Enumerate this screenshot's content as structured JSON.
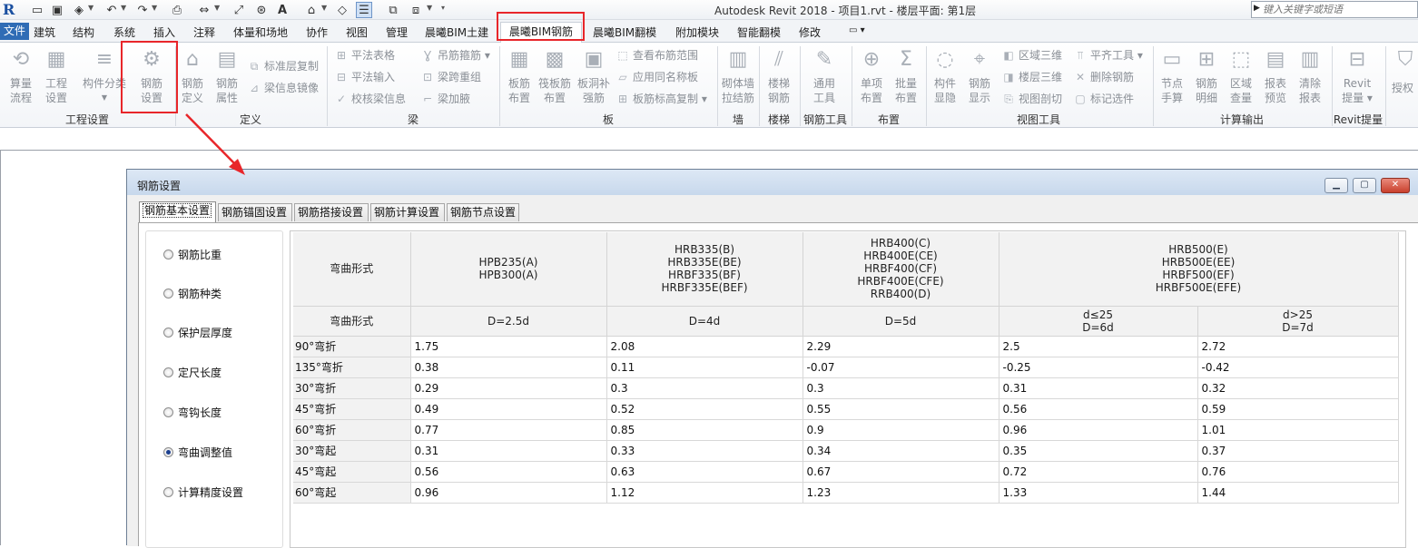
{
  "titlebar": {
    "app_logo": "R",
    "window_title": "Autodesk Revit 2018 -    项目1.rvt - 楼层平面: 第1层",
    "search_placeholder": "键入关键字或短语"
  },
  "ribbon_tabs": [
    {
      "label": "文件"
    },
    {
      "label": "建筑"
    },
    {
      "label": "结构"
    },
    {
      "label": "系统"
    },
    {
      "label": "插入"
    },
    {
      "label": "注释"
    },
    {
      "label": "体量和场地"
    },
    {
      "label": "协作"
    },
    {
      "label": "视图"
    },
    {
      "label": "管理"
    },
    {
      "label": "晨曦BIM土建"
    },
    {
      "label": "晨曦BIM钢筋"
    },
    {
      "label": "晨曦BIM翻模"
    },
    {
      "label": "附加模块"
    },
    {
      "label": "智能翻模"
    },
    {
      "label": "修改"
    }
  ],
  "ribbon": {
    "groups": {
      "project_settings": "工程设置",
      "definition": "定义",
      "beam": "梁",
      "slab": "板",
      "wall": "墙",
      "stair": "楼梯",
      "rebar_tools": "钢筋工具",
      "layout": "布置",
      "view_tools": "视图工具",
      "calc_output": "计算输出",
      "revit_extract": "Revit提量"
    },
    "buttons": {
      "calc_flow_1": "算量",
      "calc_flow_2": "流程",
      "project_set_1": "工程",
      "project_set_2": "设置",
      "component_split": "构件分类",
      "rebar_settings_1": "钢筋",
      "rebar_settings_2": "设置",
      "rebar_def_1": "钢筋",
      "rebar_def_2": "定义",
      "rebar_attr_1": "钢筋",
      "rebar_attr_2": "属性",
      "std_floor_copy": "标准层复制",
      "beam_mirror": "梁信息镜像",
      "plan_table": "平法表格",
      "plan_input": "平法输入",
      "check_beam": "校核梁信息",
      "hanger_rebar": "吊筋箍筋",
      "beam_span_regroup": "梁跨重组",
      "beam_haunch": "梁加腋",
      "slab_rebar_1": "板筋",
      "slab_rebar_2": "布置",
      "raft_rebar_1": "筏板筋",
      "raft_rebar_2": "布置",
      "slab_hole_1": "板洞补",
      "slab_hole_2": "强筋",
      "view_range": "查看布筋范围",
      "apply_same_name": "应用同名称板",
      "slab_elev_copy": "板筋标高复制",
      "masonry_1": "砌体墙",
      "masonry_2": "拉结筋",
      "stair_1": "楼梯",
      "stair_2": "钢筋",
      "general_1": "通用",
      "general_2": "工具",
      "single_1": "单项",
      "single_2": "布置",
      "batch_1": "批量",
      "batch_2": "布置",
      "comp_show_1": "构件",
      "comp_show_2": "显隐",
      "rebar_show_1": "钢筋",
      "rebar_show_2": "显示",
      "zone_3d": "区域三维",
      "floor_3d": "楼层三维",
      "view_cut": "视图剖切",
      "align_tool": "平齐工具",
      "delete_rebar": "删除钢筋",
      "mark_select": "标记选件",
      "node_1": "节点",
      "node_2": "手算",
      "detail_1": "钢筋",
      "detail_2": "明细",
      "zone_q_1": "区域",
      "zone_q_2": "查量",
      "report_1": "报表",
      "report_2": "预览",
      "clear_1": "清除",
      "clear_2": "报表",
      "revit_1": "Revit",
      "revit_2": "提量",
      "auth": "授权"
    }
  },
  "dialog": {
    "title": "钢筋设置",
    "tabs": [
      {
        "label": "钢筋基本设置"
      },
      {
        "label": "钢筋锚固设置"
      },
      {
        "label": "钢筋搭接设置"
      },
      {
        "label": "钢筋计算设置"
      },
      {
        "label": "钢筋节点设置"
      }
    ],
    "radios": [
      {
        "label": "钢筋比重"
      },
      {
        "label": "钢筋种类"
      },
      {
        "label": "保护层厚度"
      },
      {
        "label": "定尺长度"
      },
      {
        "label": "弯钩长度"
      },
      {
        "label": "弯曲调整值"
      },
      {
        "label": "计算精度设置"
      }
    ],
    "selected_radio": "弯曲调整值",
    "table": {
      "header_row1": {
        "bend_label": "弯曲形式",
        "g1": "HPB235(A)\nHPB300(A)",
        "g2": "HRB335(B)\nHRB335E(BE)\nHRBF335(BF)\nHRBF335E(BEF)",
        "g3": "HRB400(C)\nHRB400E(CE)\nHRBF400(CF)\nHRBF400E(CFE)\nRRB400(D)",
        "g4": "HRB500(E)\nHRB500E(EE)\nHRBF500(EF)\nHRBF500E(EFE)"
      },
      "header_row2": {
        "bend_label": "弯曲形式",
        "c1": "D=2.5d",
        "c2": "D=4d",
        "c3": "D=5d",
        "c4": "d≤25\nD=6d",
        "c5": "d>25\nD=7d"
      },
      "rows": [
        {
          "label": "90°弯折",
          "v": [
            "1.75",
            "2.08",
            "2.29",
            "2.5",
            "2.72"
          ]
        },
        {
          "label": "135°弯折",
          "v": [
            "0.38",
            "0.11",
            "-0.07",
            "-0.25",
            "-0.42"
          ]
        },
        {
          "label": "30°弯折",
          "v": [
            "0.29",
            "0.3",
            "0.3",
            "0.31",
            "0.32"
          ]
        },
        {
          "label": "45°弯折",
          "v": [
            "0.49",
            "0.52",
            "0.55",
            "0.56",
            "0.59"
          ]
        },
        {
          "label": "60°弯折",
          "v": [
            "0.77",
            "0.85",
            "0.9",
            "0.96",
            "1.01"
          ]
        },
        {
          "label": "30°弯起",
          "v": [
            "0.31",
            "0.33",
            "0.34",
            "0.35",
            "0.37"
          ]
        },
        {
          "label": "45°弯起",
          "v": [
            "0.56",
            "0.63",
            "0.67",
            "0.72",
            "0.76"
          ]
        },
        {
          "label": "60°弯起",
          "v": [
            "0.96",
            "1.12",
            "1.23",
            "1.33",
            "1.44"
          ]
        }
      ]
    }
  },
  "colors": {
    "highlight_red": "#e8262a",
    "file_tab_blue": "#2f6cb5"
  }
}
